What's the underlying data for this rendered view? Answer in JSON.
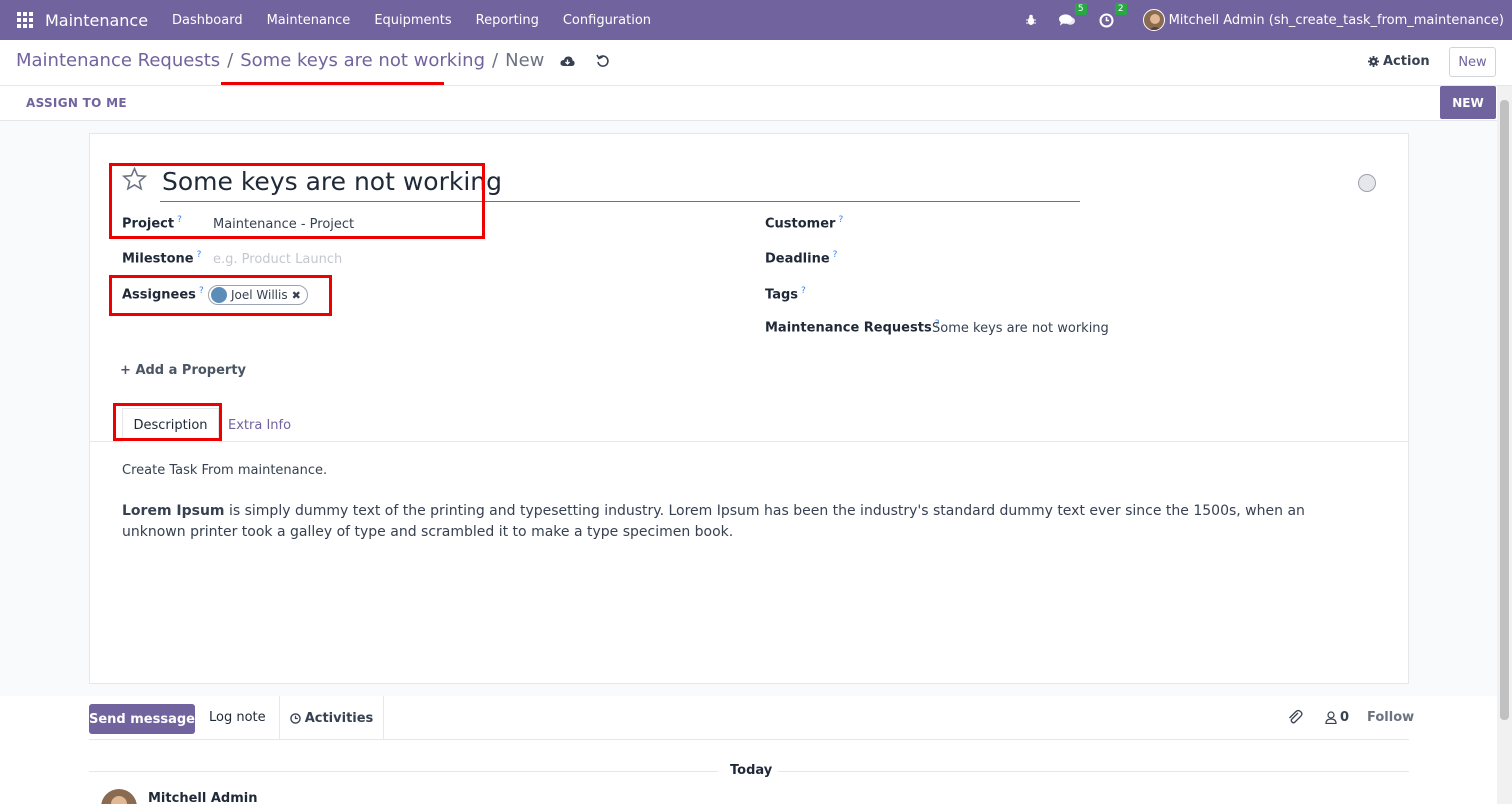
{
  "navbar": {
    "brand": "Maintenance",
    "menu": [
      "Dashboard",
      "Maintenance",
      "Equipments",
      "Reporting",
      "Configuration"
    ],
    "messages_count": "5",
    "activities_count": "2",
    "user": "Mitchell Admin (sh_create_task_from_maintenance)"
  },
  "breadcrumb": {
    "root": "Maintenance Requests",
    "parent": "Some keys are not working",
    "current": "New"
  },
  "control": {
    "action_label": "Action",
    "new_label": "New"
  },
  "statusbar": {
    "assign_label": "ASSIGN TO ME",
    "stage_label": "NEW"
  },
  "form": {
    "title": "Some keys are not working",
    "left_fields": {
      "project_label": "Project",
      "project_value": "Maintenance - Project",
      "milestone_label": "Milestone",
      "milestone_placeholder": "e.g. Product Launch",
      "assignees_label": "Assignees",
      "assignee_name": "Joel Willis"
    },
    "right_fields": {
      "customer_label": "Customer",
      "deadline_label": "Deadline",
      "tags_label": "Tags",
      "maint_label": "Maintenance Requests",
      "maint_value": "Some keys are not working"
    },
    "help_mark": "?",
    "add_property": "Add a Property",
    "tabs": [
      "Description",
      "Extra Info"
    ],
    "description": {
      "line1": "Create Task From maintenance.",
      "bold": "Lorem Ipsum",
      "rest": " is simply dummy text of the printing and typesetting industry. Lorem Ipsum has been the industry's standard dummy text ever since the 1500s, when an unknown printer took a galley of type and scrambled it to make a type specimen book."
    }
  },
  "chatter": {
    "send_label": "Send message",
    "log_label": "Log note",
    "activities_label": "Activities",
    "followers_count": "0",
    "follow_label": "Follow",
    "date_separator": "Today",
    "author": "Mitchell Admin"
  },
  "colors": {
    "brand": "#71639e",
    "highlight": "#ee0000"
  }
}
